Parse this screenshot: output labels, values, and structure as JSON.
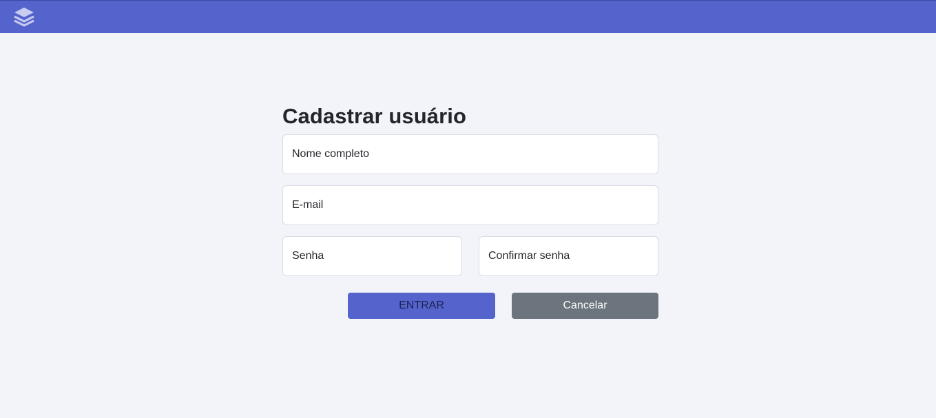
{
  "header": {
    "logo_icon": "layers-icon",
    "bar_color": "#5563cc"
  },
  "form": {
    "title": "Cadastrar usuário",
    "fields": {
      "full_name": {
        "placeholder": "Nome completo",
        "value": ""
      },
      "email": {
        "placeholder": "E-mail",
        "value": ""
      },
      "password": {
        "placeholder": "Senha",
        "value": ""
      },
      "confirm_password": {
        "placeholder": "Confirmar senha",
        "value": ""
      }
    },
    "buttons": {
      "submit_label": "ENTRAR",
      "cancel_label": "Cancelar"
    }
  },
  "colors": {
    "primary": "#5563cc",
    "secondary": "#6c757d",
    "background": "#f3f4fa"
  }
}
